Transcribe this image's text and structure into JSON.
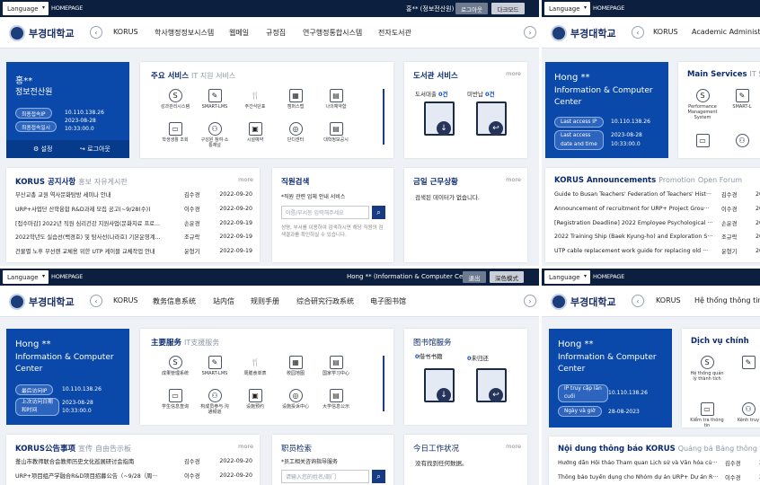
{
  "q1": {
    "language": "Language",
    "homepage": "HOMEPAGE",
    "user": "홍** (정보전산원)",
    "logout": "로그아웃",
    "darkmode": "다크모드",
    "logo": "부경대학교",
    "menu": [
      "KORUS",
      "학사행정정보시스템",
      "웹메일",
      "규정집",
      "연구행정통합시스템",
      "전자도서관"
    ],
    "profile": {
      "name": "홍**",
      "dept": "정보전산원",
      "last_ip_label": "최종접속IP",
      "last_ip": "10.110.138.26",
      "last_time_label": "최종접속일시",
      "last_date": "2023-08-28",
      "last_time": "10:33:00.0",
      "settings": "설정",
      "logout": "로그아웃"
    },
    "services": {
      "title": "주요 서비스",
      "sub": "IT 지원 서비스",
      "items": [
        "성과관리시스템",
        "SMART-LMS",
        "주간식단표",
        "캠퍼스맵",
        "나의예약함",
        "학생생활 조회",
        "구성원 참여·소통채널",
        "시설예약",
        "단디센터",
        "대학정보공시"
      ]
    },
    "library": {
      "title": "도서관 서비스",
      "more": "more",
      "loan_label": "도서대출",
      "loan_val": "0건",
      "overdue_label": "미반납",
      "overdue_val": "0건"
    },
    "notices": {
      "title": "KORUS 공지사항",
      "tab2": "홍보",
      "tab3": "자유게시판",
      "more": "more",
      "rows": [
        {
          "t": "부산교총 교원 역사문화탐방 세미나 안내",
          "a": "김수경",
          "d": "2022-09-20"
        },
        {
          "t": "URP+사업단 산학융합 R&D과제 모집 공고(~9/28(수))",
          "a": "이수경",
          "d": "2022-09-20"
        },
        {
          "t": "[접수마감] 2022년 직원 심리건강 지원사업(문화치료 프로...",
          "a": "손윤경",
          "d": "2022-09-19"
        },
        {
          "t": "2022학년도 실습선(백경호) 및 탐사선(나라호) 기본운영계...",
          "a": "조규락",
          "d": "2022-09-19"
        },
        {
          "t": "건물별 노후 무선랜 교체용 위한 UTP 케이블 교체작업 안내",
          "a": "윤형기",
          "d": "2022-09-19"
        }
      ]
    },
    "staff": {
      "title": "직원검색",
      "desc": "*직원 관련 업체 안내 서비스",
      "placeholder": "이름/부서등 입력해주세요",
      "note": "성명, 부서를 이용하여 검색하시면 해당 직원의 검색결과를 확인하실 수 있습니다."
    },
    "work": {
      "title": "금일 근무상황",
      "more": "more",
      "empty": "검색된 데이터가 없습니다."
    }
  },
  "q2": {
    "language": "Language",
    "homepage": "HOMEPAGE",
    "logo": "부경대학교",
    "menu": [
      "KORUS",
      "Academic Administra"
    ],
    "profile": {
      "name": "Hong **",
      "dept1": "Information & Computer",
      "dept2": "Center",
      "last_ip_label": "Last access IP",
      "last_ip": "10.110.138.26",
      "last_time_label1": "Last access",
      "last_time_label2": "date and time",
      "last_date": "2023-08-28",
      "last_time": "10:33:00.0"
    },
    "services": {
      "title": "Main Services",
      "sub": "IT Sup",
      "items": [
        "Performance Management System",
        "SMART-L"
      ]
    },
    "notices": {
      "title": "KORUS Announcements",
      "tab2": "Promotion",
      "tab3": "Open Forum",
      "rows": [
        {
          "t": "Guide to Busan Teachers' Federation of Teachers' Hist···",
          "a": "김수경",
          "d": "2022"
        },
        {
          "t": "Announcement of recruitment for URP+ Project Grou···",
          "a": "이수경",
          "d": "2022"
        },
        {
          "t": "[Registration Deadline] 2022 Employee Psychological ···",
          "a": "손윤경",
          "d": "2022"
        },
        {
          "t": "2022 Training Ship (Baek Kyung-ho) and Exploration S···",
          "a": "조규락",
          "d": "2022"
        },
        {
          "t": "UTP cable replacement work guide for replacing old ···",
          "a": "윤형기",
          "d": "2022"
        }
      ]
    }
  },
  "q3": {
    "language": "Language",
    "homepage": "HOMEPAGE",
    "user": "Hong ** (Information & Computer Center)",
    "logout": "退出",
    "darkmode": "深色模式",
    "logo": "부경대학교",
    "menu": [
      "KORUS",
      "教务信息系统",
      "站内信",
      "规则手册",
      "综合研究行政系统",
      "电子图书馆"
    ],
    "profile": {
      "name": "Hong **",
      "dept1": "Information & Computer",
      "dept2": "Center",
      "last_ip_label": "最后访问IP",
      "last_ip": "10.110.138.26",
      "last_time_label1": "上次访问日期",
      "last_time_label2": "和时间",
      "last_date": "2023-08-28",
      "last_time": "10:33:00.0"
    },
    "services": {
      "title": "主要服务",
      "sub": "IT支援服务",
      "items": [
        "成果管理系统",
        "SMART-LMS",
        "周膳食单表",
        "校园地图",
        "国家学习中心",
        "学生信息查询",
        "构成员参与·沟通频道",
        "设施预约",
        "设施投诉中心",
        "大学信息公示"
      ]
    },
    "library": {
      "title": "图书馆服务",
      "loan_label": "借书书籍",
      "loan_val": "0",
      "overdue_label": "未归还",
      "overdue_val": "0"
    },
    "notices": {
      "title": "KORUS公告事项",
      "tab2": "宣传",
      "tab3": "自由告示板",
      "more": "more",
      "rows": [
        {
          "t": "釜山市教师联合会教师历史文化巡展研讨会指南",
          "a": "김수경",
          "d": "2022-09-20"
        },
        {
          "t": "URP+项目组产学融合R&D项目招募公告（~9/28（周···",
          "a": "이수경",
          "d": "2022-09-20"
        }
      ]
    },
    "staff": {
      "title": "职员检索",
      "desc": "*员工相关咨询指导服务",
      "placeholder": "请输入您的姓名/部门"
    },
    "work": {
      "title": "今日工作状况",
      "more": "more",
      "empty": "没有找到任何数据。"
    }
  },
  "q4": {
    "language": "Language",
    "homepage": "HOMEPAGE",
    "logo": "부경대학교",
    "menu": [
      "KORUS",
      "Hệ thống thông tin h"
    ],
    "profile": {
      "name": "Hong **",
      "dept1": "Information & Computer",
      "dept2": "Center",
      "last_ip_label1": "IP truy cập lần",
      "last_ip_label2": "cuối",
      "last_ip": "10.110.138.26",
      "last_time_label": "Ngày và giờ",
      "last_date": "28-08-2023"
    },
    "services": {
      "title": "Dịch vụ chính",
      "items": [
        "Hệ thống quản lý thành tích",
        "Kiểm tra thông tin",
        "Kênh truy"
      ]
    },
    "notices": {
      "title": "Nội dung thông báo KORUS",
      "tab2": "Quảng bá",
      "tab3": "Bảng thông tin tự do",
      "rows": [
        {
          "t": "Hướng dẫn Hội thảo Tham quan Lịch sử và Văn hóa củ···",
          "a": "김수경",
          "d": "2022"
        },
        {
          "t": "Thông báo tuyển dụng cho Nhóm dự án URP+ Dự án R···",
          "a": "이수경",
          "d": "2022"
        }
      ]
    }
  },
  "colors": {
    "navy": "#0c1f3e",
    "blue": "#0a49a9",
    "accent": "#0a49c9"
  }
}
